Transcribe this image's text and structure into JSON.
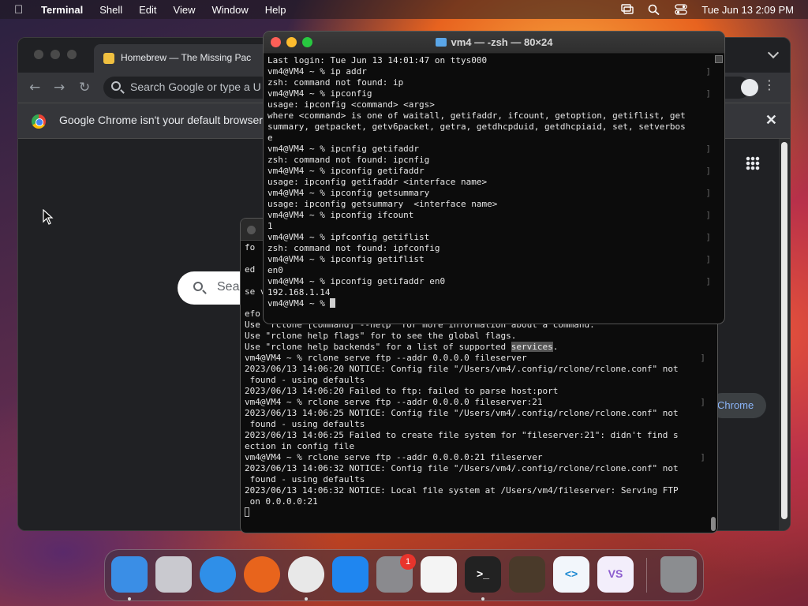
{
  "menubar": {
    "app_name": "Terminal",
    "menus": [
      "Shell",
      "Edit",
      "View",
      "Window",
      "Help"
    ],
    "clock": "Tue Jun 13  2:09 PM"
  },
  "chrome": {
    "tab_title": "Homebrew — The Missing Pac",
    "omnibox_placeholder": "Search Google or type a U",
    "infobar_text": "Google Chrome isn't your default browser",
    "search_placeholder": "Sea",
    "set_default_label": "Chrome"
  },
  "terminal_front": {
    "title": "vm4 — -zsh — 80×24",
    "lines": [
      {
        "t": "Last login: Tue Jun 13 14:01:47 on ttys000",
        "b": false
      },
      {
        "t": "vm4@VM4 ~ % ip addr",
        "b": true
      },
      {
        "t": "zsh: command not found: ip",
        "b": false
      },
      {
        "t": "vm4@VM4 ~ % ipconfig",
        "b": true
      },
      {
        "t": "usage: ipconfig <command> <args>",
        "b": false
      },
      {
        "t": "where <command> is one of waitall, getifaddr, ifcount, getoption, getiflist, get",
        "b": false
      },
      {
        "t": "summary, getpacket, getv6packet, getra, getdhcpduid, getdhcpiaid, set, setverbos",
        "b": false
      },
      {
        "t": "e",
        "b": false
      },
      {
        "t": "vm4@VM4 ~ % ipcnfig getifaddr",
        "b": true
      },
      {
        "t": "zsh: command not found: ipcnfig",
        "b": false
      },
      {
        "t": "vm4@VM4 ~ % ipconfig getifaddr",
        "b": true
      },
      {
        "t": "usage: ipconfig getifaddr <interface name>",
        "b": false
      },
      {
        "t": "vm4@VM4 ~ % ipconfig getsummary",
        "b": true
      },
      {
        "t": "usage: ipconfig getsummary  <interface name>",
        "b": false
      },
      {
        "t": "vm4@VM4 ~ % ipconfig ifcount",
        "b": true
      },
      {
        "t": "1",
        "b": false
      },
      {
        "t": "vm4@VM4 ~ % ipfconfig getiflist",
        "b": true
      },
      {
        "t": "zsh: command not found: ipfconfig",
        "b": false
      },
      {
        "t": "vm4@VM4 ~ % ipconfig getiflist",
        "b": true
      },
      {
        "t": "en0",
        "b": false
      },
      {
        "t": "vm4@VM4 ~ % ipconfig getifaddr en0",
        "b": true
      },
      {
        "t": "192.168.1.14",
        "b": false
      }
    ],
    "prompt": "vm4@VM4 ~ % "
  },
  "terminal_back": {
    "peek_lines": [
      "fo",
      "",
      "ed ",
      "",
      "se v",
      "",
      "efo"
    ],
    "lines": [
      {
        "t": "Use \"rclone [command] --help\" for more information about a command.",
        "b": false
      },
      {
        "t": "Use \"rclone help flags\" for to see the global flags.",
        "b": false
      },
      {
        "t": "Use \"rclone help backends\" for a list of supported ",
        "hl": "services",
        "tail": ".",
        "b": false
      },
      {
        "t": "vm4@VM4 ~ % rclone serve ftp --addr 0.0.0.0 fileserver",
        "b": true
      },
      {
        "t": "2023/06/13 14:06:20 NOTICE: Config file \"/Users/vm4/.config/rclone/rclone.conf\" not",
        "b": false
      },
      {
        "t": " found - using defaults",
        "b": false
      },
      {
        "t": "2023/06/13 14:06:20 Failed to ftp: failed to parse host:port",
        "b": false
      },
      {
        "t": "vm4@VM4 ~ % rclone serve ftp --addr 0.0.0.0 fileserver:21",
        "b": true
      },
      {
        "t": "2023/06/13 14:06:25 NOTICE: Config file \"/Users/vm4/.config/rclone/rclone.conf\" not",
        "b": false
      },
      {
        "t": " found - using defaults",
        "b": false
      },
      {
        "t": "2023/06/13 14:06:25 Failed to create file system for \"fileserver:21\": didn't find s",
        "b": false
      },
      {
        "t": "ection in config file",
        "b": false
      },
      {
        "t": "vm4@VM4 ~ % rclone serve ftp --addr 0.0.0.0:21 fileserver",
        "b": true
      },
      {
        "t": "2023/06/13 14:06:32 NOTICE: Config file \"/Users/vm4/.config/rclone/rclone.conf\" not",
        "b": false
      },
      {
        "t": " found - using defaults",
        "b": false
      },
      {
        "t": "2023/06/13 14:06:32 NOTICE: Local file system at /Users/vm4/fileserver: Serving FTP",
        "b": false
      },
      {
        "t": " on 0.0.0.0:21",
        "b": false
      }
    ]
  },
  "dock": {
    "settings_badge": "1",
    "apps": [
      {
        "name": "finder",
        "color": "#3a8ee6",
        "running": true
      },
      {
        "name": "launchpad",
        "color": "#c9c9cf",
        "running": false
      },
      {
        "name": "safari",
        "color": "#2f8fe8",
        "running": false
      },
      {
        "name": "firefox",
        "color": "#e8641c",
        "running": false
      },
      {
        "name": "chrome",
        "color": "#e8e8e8",
        "running": true
      },
      {
        "name": "app-store",
        "color": "#1f86f0",
        "running": false
      },
      {
        "name": "system-settings",
        "color": "#8a8a8e",
        "running": false
      },
      {
        "name": "textedit",
        "color": "#f4f4f4",
        "running": false
      },
      {
        "name": "terminal",
        "color": "#222222",
        "running": true
      },
      {
        "name": "garageband",
        "color": "#4a3a2a",
        "running": false
      },
      {
        "name": "vscode",
        "color": "#f2f6fb",
        "running": false
      },
      {
        "name": "visual-studio",
        "color": "#f3eefb",
        "running": false
      },
      {
        "name": "trash",
        "color": "#8b8d90",
        "running": false
      }
    ]
  },
  "colors": {
    "traffic_red": "#fe5f57",
    "traffic_yellow": "#febc2e",
    "traffic_green": "#28c840"
  }
}
